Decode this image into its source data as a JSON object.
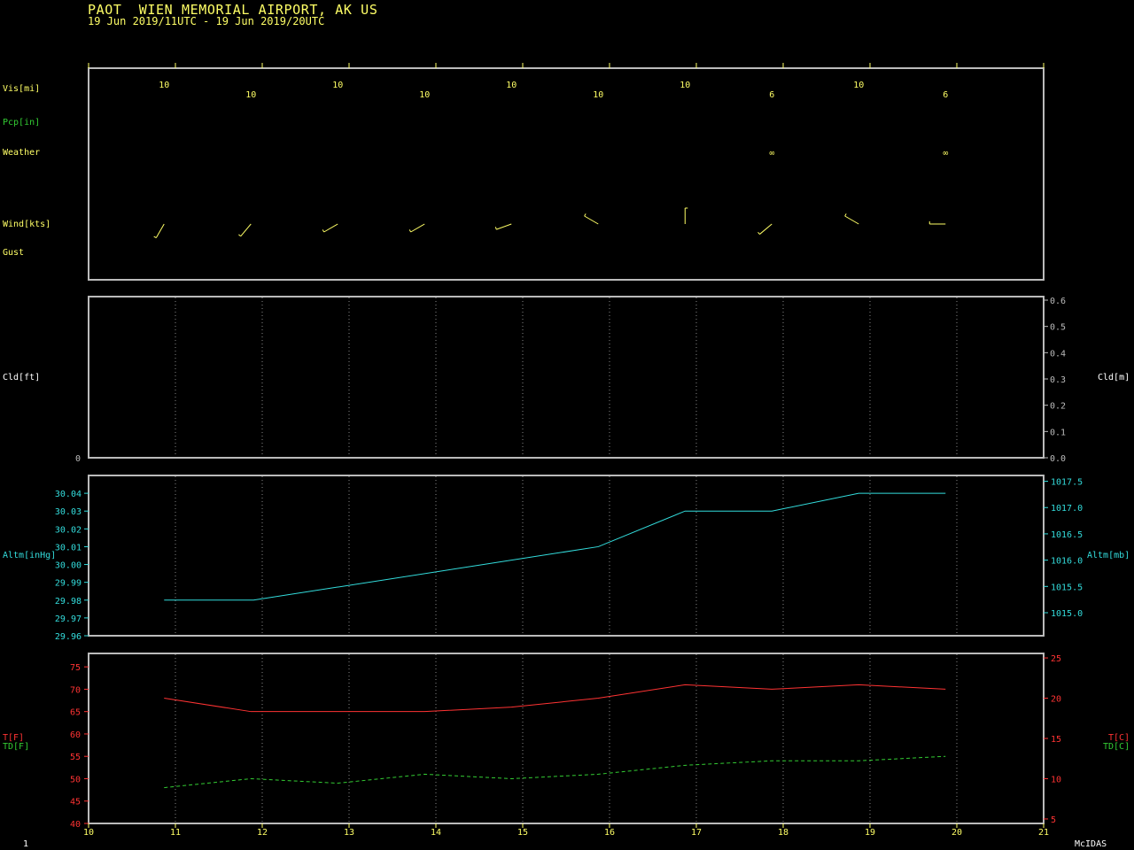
{
  "header": {
    "title": "PAOT  WIEN MEMORIAL AIRPORT, AK US",
    "subtitle": "19 Jun 2019/11UTC - 19 Jun 2019/20UTC"
  },
  "footer": {
    "left": "1",
    "right": "McIDAS"
  },
  "colors": {
    "yellow": "#ffff66",
    "green": "#33cc33",
    "cyan": "#33dddd",
    "red": "#ff3333",
    "frame": "#bbbbbb",
    "grid": "#888888"
  },
  "chart_data": [
    {
      "type": "table",
      "panel": "surface-obs",
      "row_labels": {
        "vis": "Vis[mi]",
        "pcp": "Pcp[in]",
        "weather": "Weather",
        "wind": "Wind[kts]",
        "gust": "Gust"
      },
      "x": [
        10.87,
        11.87,
        12.87,
        13.87,
        14.87,
        15.87,
        16.87,
        17.87,
        18.87,
        19.87
      ],
      "visibility": [
        "10",
        "10",
        "10",
        "10",
        "10",
        "10",
        "10",
        "6",
        "10",
        "6"
      ],
      "weather": [
        "",
        "",
        "",
        "",
        "",
        "",
        "",
        "∞",
        "",
        "∞"
      ],
      "wind_direction_deg": [
        210,
        220,
        240,
        240,
        250,
        300,
        360,
        230,
        300,
        270
      ]
    },
    {
      "type": "line",
      "panel": "cloud",
      "ylabel_left": "Cld[ft]",
      "ylabel_right": "Cld[m]",
      "left_ticks": [
        "0"
      ],
      "right_ticks": [
        "0.0",
        "0.1",
        "0.2",
        "0.3",
        "0.4",
        "0.5",
        "0.6"
      ],
      "ylim_right": [
        0,
        0.6
      ],
      "series": []
    },
    {
      "type": "line",
      "panel": "altimeter",
      "ylabel_left": "Altm[inHg]",
      "ylabel_right": "Altm[mb]",
      "ylim": [
        29.96,
        30.05
      ],
      "left_ticks": [
        "29.96",
        "29.97",
        "29.98",
        "29.99",
        "30.00",
        "30.01",
        "30.02",
        "30.03",
        "30.04"
      ],
      "right_ticks": [
        "1015.0",
        "1015.5",
        "1016.0",
        "1016.5",
        "1017.0",
        "1017.5"
      ],
      "x": [
        10.87,
        11.9,
        15.87,
        16.87,
        17.87,
        18.87,
        19.87
      ],
      "series": [
        {
          "values": [
            29.98,
            29.98,
            30.01,
            30.03,
            30.03,
            30.04,
            30.04
          ]
        }
      ]
    },
    {
      "type": "line",
      "panel": "temperature",
      "ylabel_left_t": "T[F]",
      "ylabel_left_td": "TD[F]",
      "ylabel_right_t": "T[C]",
      "ylabel_right_td": "TD[C]",
      "ylim": [
        40,
        78
      ],
      "left_ticks": [
        "40",
        "45",
        "50",
        "55",
        "60",
        "65",
        "70",
        "75"
      ],
      "right_ticks": [
        "5",
        "10",
        "15",
        "20",
        "25"
      ],
      "x": [
        10.87,
        11.87,
        12.87,
        13.87,
        14.87,
        15.87,
        16.87,
        17.87,
        18.87,
        19.87
      ],
      "series": [
        {
          "values": [
            68,
            65,
            65,
            65,
            66,
            68,
            71,
            70,
            71,
            70
          ]
        },
        {
          "values": [
            48,
            50,
            49,
            51,
            50,
            51,
            53,
            54,
            54,
            55
          ]
        }
      ],
      "x_ticks": [
        "10",
        "11",
        "12",
        "13",
        "14",
        "15",
        "16",
        "17",
        "18",
        "19",
        "20",
        "21"
      ],
      "xlim": [
        10,
        21
      ]
    }
  ]
}
